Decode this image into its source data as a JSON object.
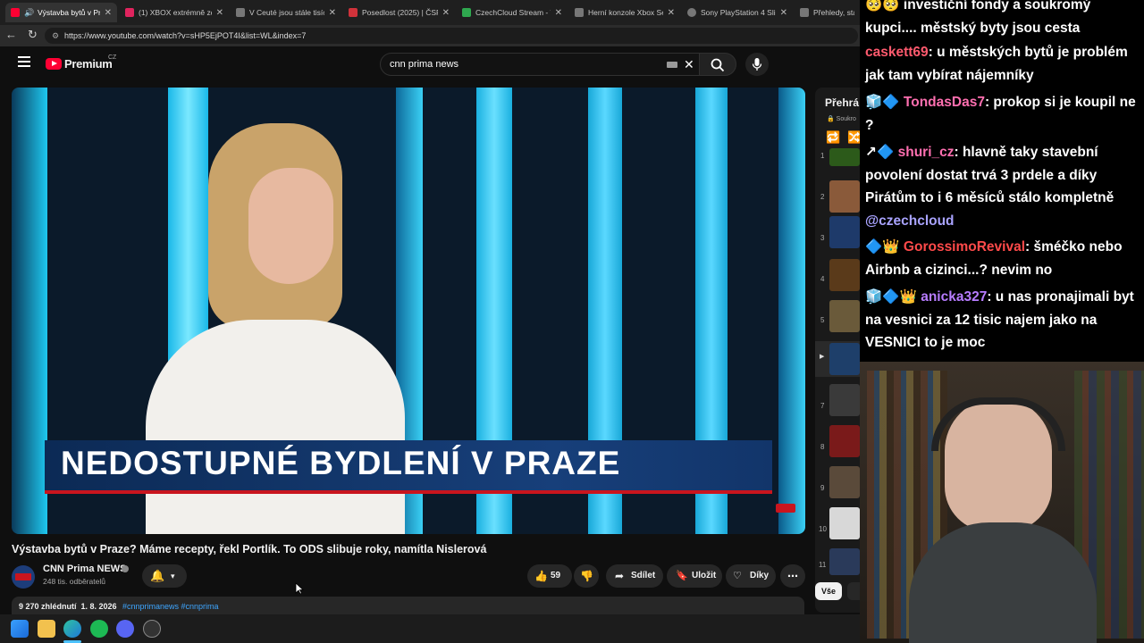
{
  "browser": {
    "tabs": [
      {
        "label": "Výstavba bytů v Pra",
        "color": "#ff0033",
        "active": true
      },
      {
        "label": "(1) XBOX extrémně zdra",
        "color": "#e0245e"
      },
      {
        "label": "V Ceuté jsou stále tisíce",
        "color": "#777777"
      },
      {
        "label": "Posedlost (2025) | ČSFD",
        "color": "#d0323a"
      },
      {
        "label": "CzechCloud Stream - W",
        "color": "#2fa84f"
      },
      {
        "label": "Herní konzole Xbox Seri",
        "color": "#777777"
      },
      {
        "label": "Sony PlayStation 4 Slim",
        "color": "#777777"
      },
      {
        "label": "Přehledy, statisti",
        "color": "#777777"
      }
    ],
    "url": "https://www.youtube.com/watch?v=sHP5EjPOT4I&list=WL&index=7"
  },
  "youtube": {
    "logo": "Premium",
    "logo_region": "CZ",
    "search_value": "cnn prima news",
    "video": {
      "overlay_title": "NEDOSTUPNÉ BYDLENÍ V PRAZE",
      "title": "Výstavba bytů v Praze? Máme recepty, řekl Portlík. To ODS slibuje roky, namítla Nislerová",
      "channel": "CNN Prima NEWS",
      "subscribers": "248 tis. odběratelů",
      "likes": "59",
      "share": "Sdílet",
      "save": "Uložit",
      "thanks": "Díky",
      "views_date": "9 270 zhlédnutí  1. 8. 2026",
      "hashtags": "#cnnprimanews #cnnprima"
    },
    "playlist": {
      "title": "Přehrá",
      "privacy": "Soukro",
      "items": [
        "1",
        "2",
        "3",
        "4",
        "5",
        "▶",
        "7",
        "8",
        "9",
        "10",
        "11"
      ]
    },
    "filter_chip": "Vše"
  },
  "chat": {
    "messages": [
      {
        "user": "",
        "user_color": "#ffffff",
        "badges": "🥺🥺",
        "text": "investiční fondy a soukromý kupci.... městský byty jsou cesta"
      },
      {
        "user": "caskett69",
        "user_color": "#ff5a6e",
        "badges": "",
        "text": ": u městských bytů je problém jak tam vybírat nájemníky"
      },
      {
        "user": "TondasDas7",
        "user_color": "#ff6fb0",
        "badges": "🧊🔷",
        "text": ": prokop si je koupil ne ?"
      },
      {
        "user": "shuri_cz",
        "user_color": "#ff6fb0",
        "badges": "↗🔷",
        "text": ": hlavně taky stavební povolení dostat trvá 3 prdele a díky Pirátům to i 6 měsíců stálo kompletně"
      },
      {
        "user": "@czechcloud",
        "user_color": "#a9a3ff",
        "badges": "",
        "text": ""
      },
      {
        "user": "GorossimoRevival",
        "user_color": "#ff4a4a",
        "badges": "🔷👑",
        "text": ": šméčko nebo Airbnb a cizinci...? nevim no"
      },
      {
        "user": "anicka327",
        "user_color": "#b77cff",
        "badges": "🧊🔷👑",
        "text": ": u nas pronajimali byt na vesnici za 12 tisic najem jako na VESNICI to je moc"
      }
    ]
  }
}
